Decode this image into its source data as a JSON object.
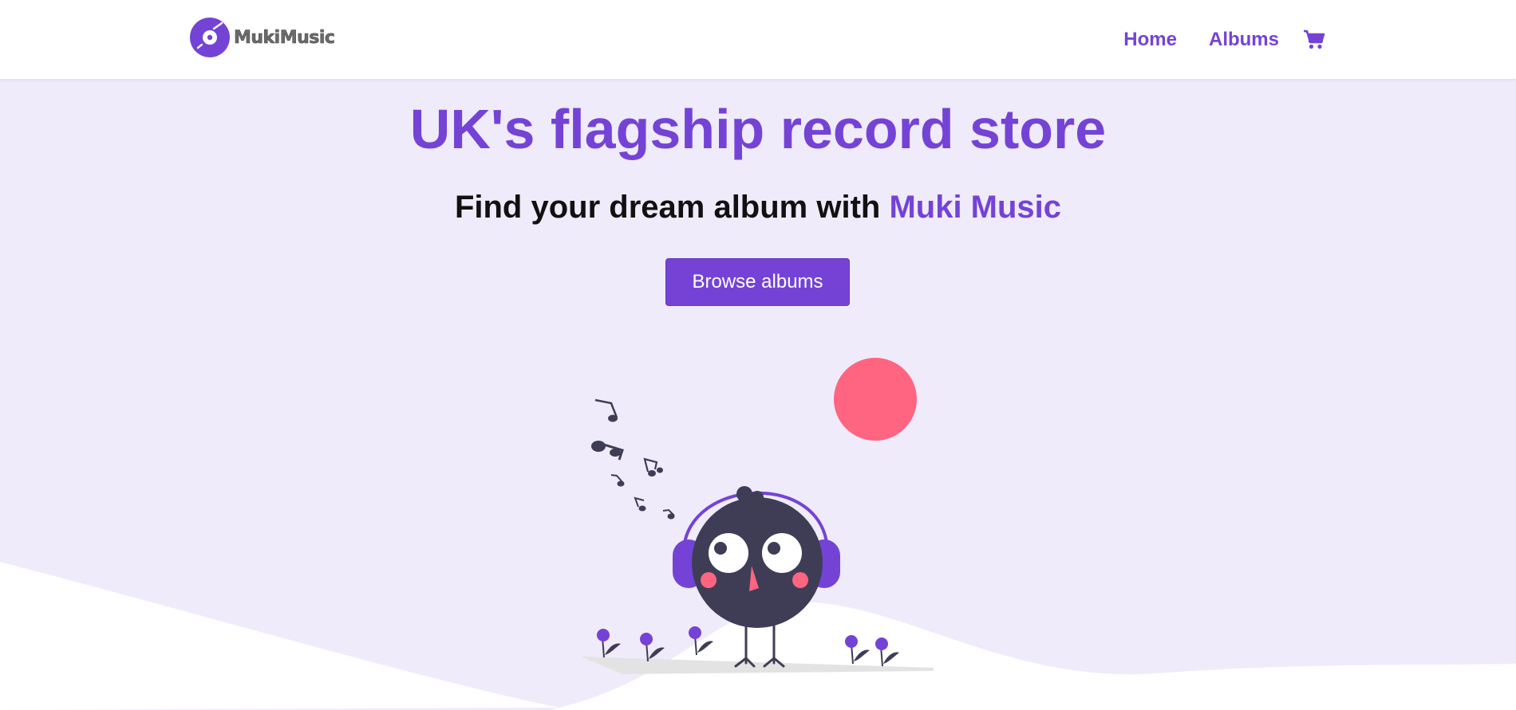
{
  "brand": {
    "name": "MukiMusic",
    "accent": "#7443d6",
    "pink": "#ff6481",
    "dark": "#3f3d56"
  },
  "nav": {
    "items": [
      {
        "label": "Home"
      },
      {
        "label": "Albums"
      }
    ],
    "cart_icon": "shopping-cart-icon"
  },
  "hero": {
    "title": "UK's flagship record store",
    "subtitle_prefix": "Find your dream album with ",
    "subtitle_accent": "Muki Music",
    "cta_label": "Browse albums"
  },
  "illustration": {
    "subject": "bird-with-headphones",
    "icons": [
      "music-notes-icon",
      "sun-icon",
      "flower-icon"
    ]
  }
}
